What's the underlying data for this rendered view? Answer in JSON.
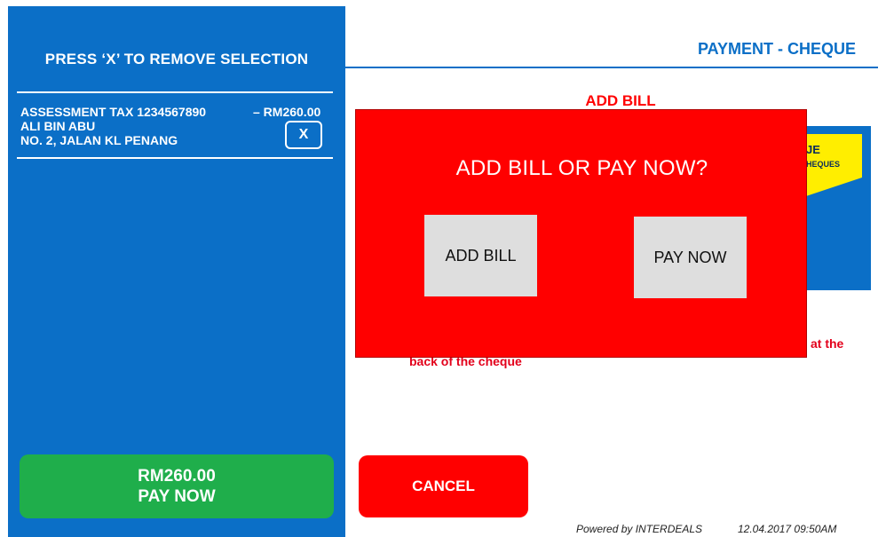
{
  "left": {
    "instruction": "PRESS ‘X’ TO REMOVE SELECTION",
    "bill": {
      "line1": "ASSESSMENT TAX 1234567890",
      "amount": "– RM260.00",
      "name": "ALI BIN ABU",
      "address": "NO. 2, JALAN KL PENANG",
      "remove_label": "X"
    },
    "pay_amount": "RM260.00",
    "pay_label": "PAY NOW"
  },
  "header": {
    "title": "PAYMENT - CHEQUE"
  },
  "background": {
    "add_bill_heading": "ADD BILL",
    "card_text_large": "JE",
    "card_text_small": "HEQUES",
    "warn_right": "at the",
    "warn_bottom": "back of the cheque"
  },
  "modal": {
    "title": "ADD BILL OR PAY NOW?",
    "add_bill_label": "ADD BILL",
    "pay_now_label": "PAY NOW"
  },
  "cancel_label": "CANCEL",
  "footer": {
    "powered_by": "Powered by INTERDEALS",
    "datetime": "12.04.2017  09:50AM"
  },
  "colors": {
    "primary_blue": "#0b6fc7",
    "pay_green": "#1fae4b",
    "alert_red": "#ff0000",
    "card_yellow": "#ffee00"
  }
}
